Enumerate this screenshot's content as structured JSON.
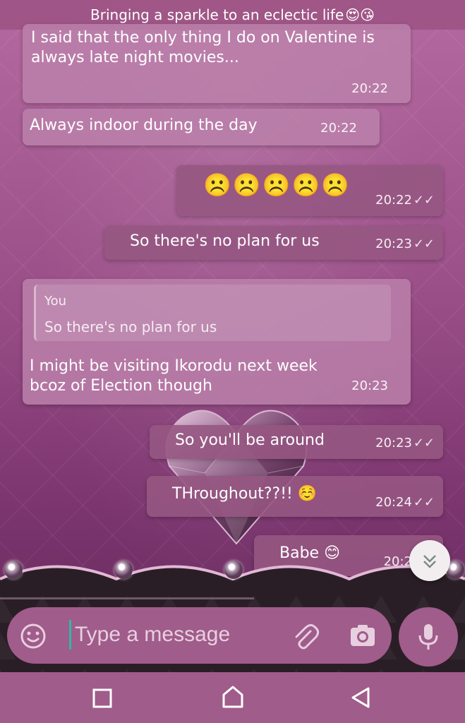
{
  "header": {
    "title": "Bringing a sparkle to an eclectic life",
    "emojis": "😍😘"
  },
  "messages": [
    {
      "dir": "in",
      "text": "I said that the only thing I do on Valentine is always late night movies...",
      "time": "20:22"
    },
    {
      "dir": "in",
      "text": "Always indoor during the day",
      "time": "20:22"
    },
    {
      "dir": "out",
      "text": "☹️☹️☹️☹️☹️",
      "time": "20:22",
      "ticks": "✓✓"
    },
    {
      "dir": "out",
      "text": "So there's no plan for us",
      "time": "20:23",
      "ticks": "✓✓"
    },
    {
      "dir": "in",
      "quote_name": "You",
      "quote_text": "So there's no plan for us",
      "text": "I might be visiting Ikorodu next week bcoz of Election though",
      "time": "20:23"
    },
    {
      "dir": "out",
      "text": "So you'll be around",
      "time": "20:23",
      "ticks": "✓✓"
    },
    {
      "dir": "out",
      "text": "THroughout??!! ☺️",
      "time": "20:24",
      "ticks": "✓✓"
    },
    {
      "dir": "out",
      "text": "Babe 😊",
      "time": "20:2",
      "ticks": ""
    }
  ],
  "composer": {
    "placeholder": "Type a message",
    "icons": [
      "smiley-icon",
      "attach-icon",
      "camera-icon",
      "mic-icon"
    ]
  },
  "scroll_button": {
    "icon": "double-chevron-down-icon"
  },
  "navbar": {
    "icons": [
      "recents-icon",
      "home-icon",
      "back-icon"
    ]
  },
  "colors": {
    "accent": "#a05c8a",
    "cursor": "#2fb8a8"
  }
}
